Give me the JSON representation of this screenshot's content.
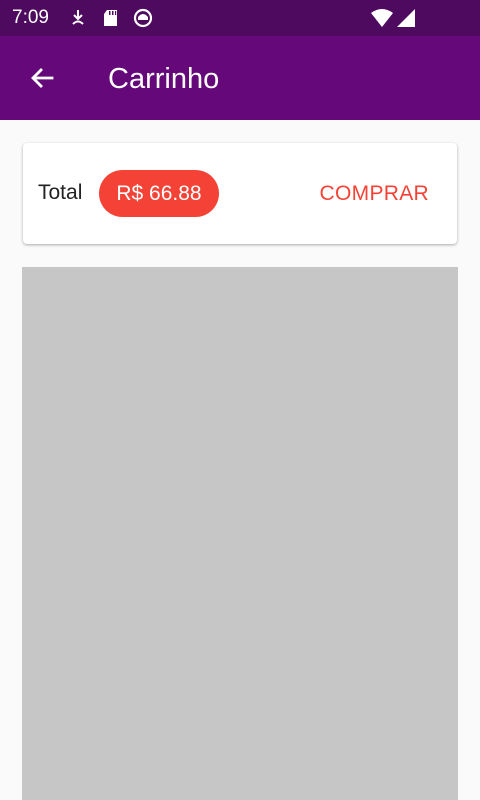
{
  "status_bar": {
    "time": "7:09",
    "icons": [
      "download-icon",
      "sd-card-icon",
      "app-notification-icon",
      "wifi-icon",
      "cell-signal-icon"
    ]
  },
  "app_bar": {
    "title": "Carrinho",
    "back_icon": "arrow-back-icon"
  },
  "cart_summary": {
    "total_label": "Total",
    "total_value": "R$ 66.88",
    "buy_label": "COMPRAR"
  },
  "colors": {
    "status_bar": "#4d0a5e",
    "app_bar": "#65097a",
    "accent": "#f44336",
    "placeholder": "#c6c6c6"
  }
}
